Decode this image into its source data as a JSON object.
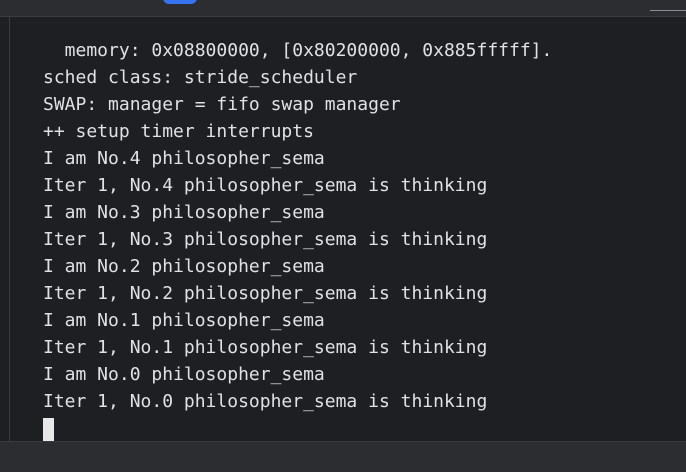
{
  "terminal": {
    "lines": [
      "  memory: 0x08800000, [0x80200000, 0x885fffff].",
      "sched class: stride_scheduler",
      "SWAP: manager = fifo swap manager",
      "++ setup timer interrupts",
      "I am No.4 philosopher_sema",
      "Iter 1, No.4 philosopher_sema is thinking",
      "I am No.3 philosopher_sema",
      "Iter 1, No.3 philosopher_sema is thinking",
      "I am No.2 philosopher_sema",
      "Iter 1, No.2 philosopher_sema is thinking",
      "I am No.1 philosopher_sema",
      "Iter 1, No.1 philosopher_sema is thinking",
      "I am No.0 philosopher_sema",
      "Iter 1, No.0 philosopher_sema is thinking"
    ]
  },
  "colors": {
    "background": "#1e1f22",
    "text": "#dfe1e5",
    "accent": "#3574f0",
    "cursor": "#e8e8e8"
  },
  "icons": {
    "cursor": "terminal-cursor-block"
  }
}
